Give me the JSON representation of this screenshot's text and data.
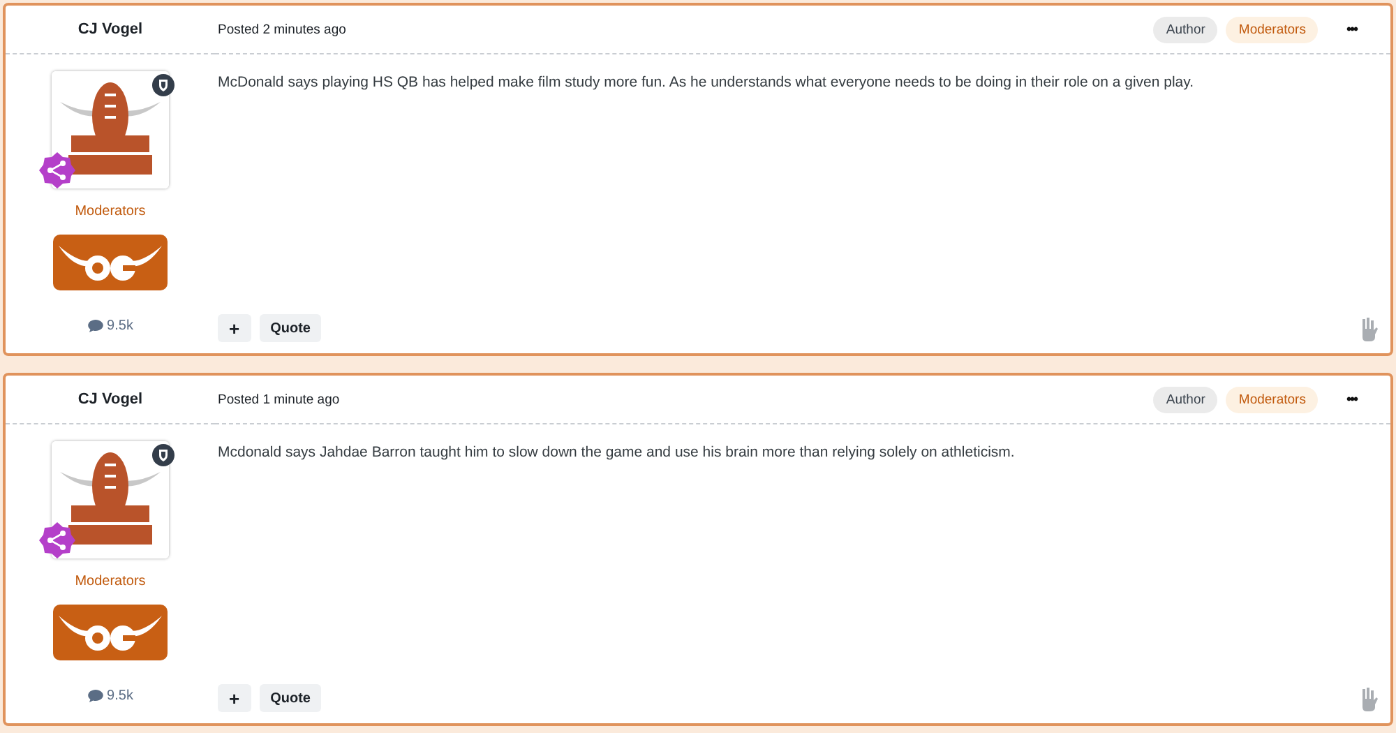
{
  "posts": [
    {
      "author": "CJ Vogel",
      "posted": "Posted 2 minutes ago",
      "badges": [
        {
          "label": "Author",
          "kind": "author"
        },
        {
          "label": "Moderators",
          "kind": "group"
        }
      ],
      "more": "•••",
      "group": "Moderators",
      "count": "9.5k",
      "body": "McDonald says playing HS QB has helped make film study more fun. As he understands what everyone needs to be doing in their role on a given play.",
      "buttons": [
        "+",
        "Quote"
      ]
    },
    {
      "author": "CJ Vogel",
      "posted": "Posted 1 minute ago",
      "badges": [
        {
          "label": "Author",
          "kind": "author"
        },
        {
          "label": "Moderators",
          "kind": "group"
        }
      ],
      "more": "•••",
      "group": "Moderators",
      "count": "9.5k",
      "body": "Mcdonald says Jahdae Barron taught him to slow down the game and use his brain more than relying solely on athleticism.",
      "buttons": [
        "+",
        "Quote"
      ]
    }
  ]
}
